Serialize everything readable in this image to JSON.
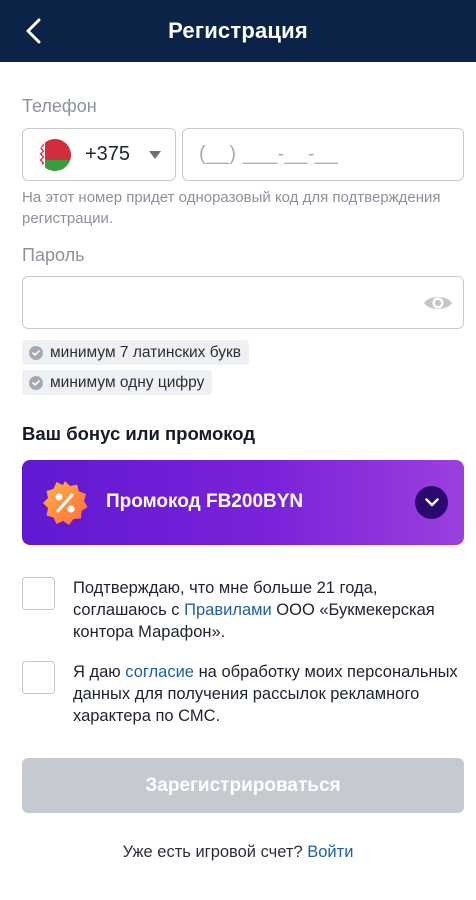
{
  "header": {
    "title": "Регистрация",
    "back_icon": "chevron-left-icon"
  },
  "phone": {
    "label": "Телефон",
    "country_code": "+375",
    "country_flag": "belarus-flag-icon",
    "placeholder": "(__) ___-__-__",
    "hint": "На этот номер придет одноразовый код для подтверждения регистрации."
  },
  "password": {
    "label": "Пароль",
    "value": "",
    "visibility_icon": "eye-icon",
    "requirements": [
      "минимум 7 латинских букв",
      "минимум одну цифру"
    ]
  },
  "bonus": {
    "section_title": "Ваш бонус или промокод",
    "promo_label": "Промокод FB200BYN",
    "badge_icon": "percent-badge-icon",
    "toggle_icon": "chevron-down-icon"
  },
  "consents": [
    {
      "before": "Подтверждаю, что мне больше 21 года, соглашаюсь с ",
      "link": "Правилами",
      "after": " ООО «Букмекерская контора Марафон».",
      "checked": false
    },
    {
      "before": "Я даю ",
      "link": "согласие",
      "after": " на обработку моих персональных данных для получения рассылок рекламного характера по СМС.",
      "checked": false
    }
  ],
  "actions": {
    "register_label": "Зарегистрироваться",
    "login_prompt": "Уже есть игровой счет?",
    "login_link": "Войти"
  },
  "colors": {
    "header_bg": "#0b2347",
    "promo_gradient_start": "#6019d1",
    "promo_gradient_end": "#9b3fde",
    "link": "#1f5ea8",
    "button_disabled": "#c5cad1"
  }
}
